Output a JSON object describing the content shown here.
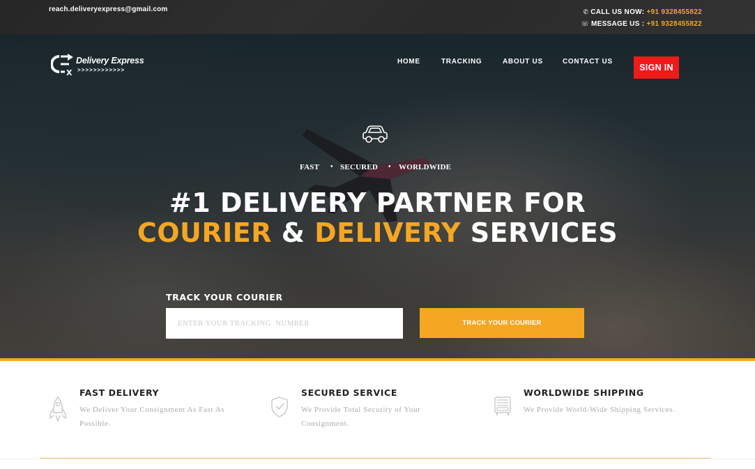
{
  "topbar": {
    "email": "reach.deliveryexpress@gmail.com",
    "call_label": "CALL US NOW: ",
    "call_number": "+91 9328455822",
    "message_label": "MESSAGE US : ",
    "message_number": "+91 9328455822"
  },
  "brand": {
    "name": "Delivery Express",
    "arrows": ">>>>>>>>>>>>"
  },
  "nav": {
    "items": [
      {
        "label": "HOME"
      },
      {
        "label": "TRACKING"
      },
      {
        "label": "ABOUT US"
      },
      {
        "label": "CONTACT US"
      }
    ],
    "signin_label": "SIGN IN"
  },
  "hero": {
    "tags": [
      "FAST",
      "SECURED",
      "WORLDWIDE"
    ],
    "separator": "•",
    "headline_line1": "#1 DELIVERY PARTNER FOR",
    "headline_word1": "COURIER",
    "headline_amp": " & ",
    "headline_word2": "DELIVERY",
    "headline_word3": " SERVICES"
  },
  "tracking": {
    "label": "TRACK YOUR COURIER",
    "placeholder": "ENTER YOUR TRACKING  NUMBER",
    "button_label": "TRACK YOUR COURIER"
  },
  "features": [
    {
      "title": "FAST DELIVERY",
      "desc": "We Deliver Your Consignment As Fast As Possible.",
      "icon": "rocket-icon"
    },
    {
      "title": "SECURED SERVICE",
      "desc": "We Provide Total Security of Your Consignment.",
      "icon": "shield-icon"
    },
    {
      "title": "WORLDWIDE SHIPPING",
      "desc": "We Provide World-Wide Shipping Services.",
      "icon": "truck-icon"
    }
  ],
  "colors": {
    "accent": "#f5a623",
    "signin": "#ee1b1b",
    "topbar": "#2b2b2b"
  }
}
